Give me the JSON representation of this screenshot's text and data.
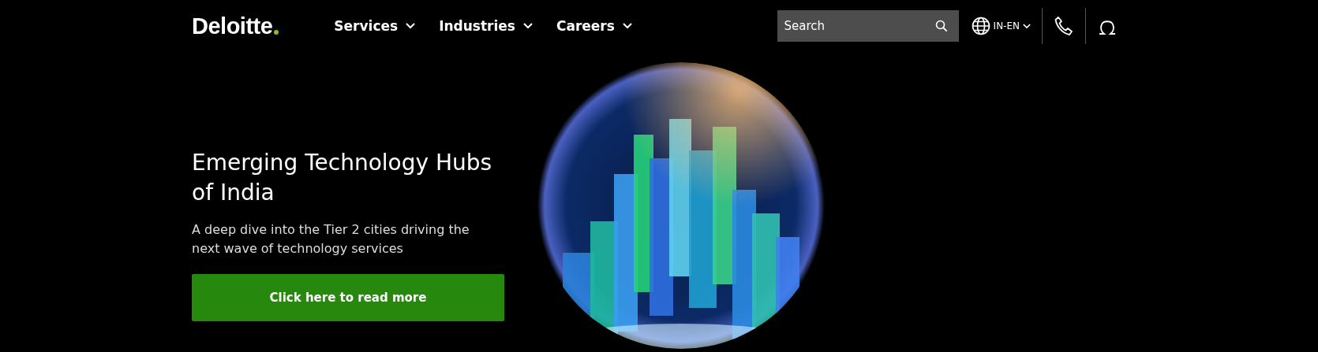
{
  "header": {
    "logo": "Deloitte",
    "nav": [
      {
        "label": "Services",
        "expanded": false
      },
      {
        "label": "Industries",
        "expanded": false
      },
      {
        "label": "Careers",
        "expanded": false
      }
    ],
    "search": {
      "placeholder": "Search"
    },
    "locale": "IN-EN"
  },
  "hero": {
    "title": "Emerging Technology Hubs of India",
    "subtitle": "A deep dive into the Tier 2 cities driving the next wave of technology services",
    "button": "Click here to read more"
  }
}
